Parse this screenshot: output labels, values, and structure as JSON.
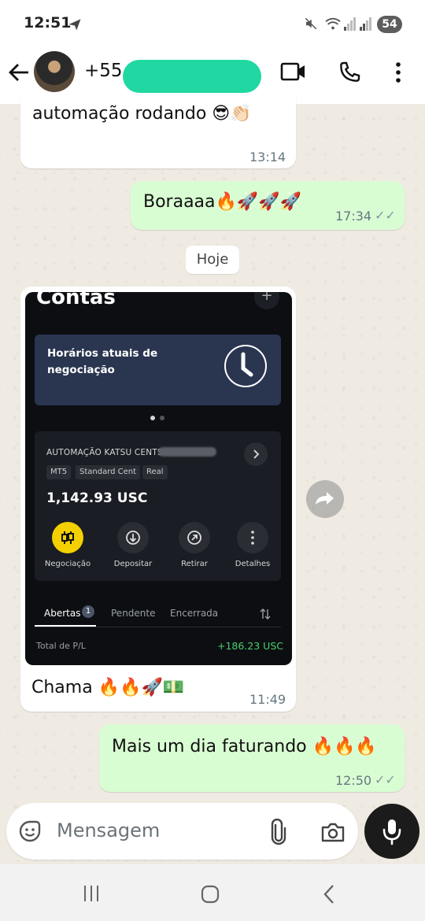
{
  "status_bar": {
    "time": "12:51",
    "battery": "54"
  },
  "header": {
    "contact": "+55 66 998"
  },
  "messages": [
    {
      "text": "automação rodando 😎👏🏻",
      "time": "13:14",
      "direction": "in"
    },
    {
      "text": "Boraaaa🔥🚀🚀🚀",
      "time": "17:34",
      "direction": "out",
      "ticks": "✓✓"
    },
    {
      "text": "Chama 🔥🔥🚀💵",
      "time": "11:49",
      "direction": "in"
    },
    {
      "text": "Mais um dia faturando 🔥🔥🔥",
      "time": "12:50",
      "direction": "out",
      "ticks": "✓✓"
    }
  ],
  "date_separator": "Hoje",
  "screenshot": {
    "title": "Contas",
    "plus": "+",
    "hours_label": "Horários atuais de negociação",
    "account_name": "AUTOMAÇÃO KATSU CENTS",
    "tags": [
      "MT5",
      "Standard Cent",
      "Real"
    ],
    "balance": "1,142.93 USC",
    "actions": [
      {
        "label": "Negociação",
        "icon": "trade-icon"
      },
      {
        "label": "Depositar",
        "icon": "deposit-icon"
      },
      {
        "label": "Retirar",
        "icon": "withdraw-icon"
      },
      {
        "label": "Detalhes",
        "icon": "more-icon"
      }
    ],
    "tabs": [
      "Abertas",
      "Pendente",
      "Encerrada"
    ],
    "open_count": "1",
    "pl_label": "Total de P/L",
    "pl_value": "+186.23 USC"
  },
  "input": {
    "placeholder": "Mensagem"
  },
  "colors": {
    "bubble_out": "#d9fdd3",
    "bubble_in": "#ffffff",
    "chat_bg": "#efeae2",
    "profit": "#4cd06a",
    "accent_yellow": "#f5d000"
  },
  "icons": [
    "send-icon",
    "mute-icon",
    "wifi-icon",
    "signal-icon",
    "back-arrow-icon",
    "video-call-icon",
    "phone-icon",
    "more-vert-icon",
    "forward-icon",
    "emoji-icon",
    "attach-icon",
    "camera-icon",
    "mic-icon",
    "nav-recents-icon",
    "nav-home-icon",
    "nav-back-icon"
  ]
}
